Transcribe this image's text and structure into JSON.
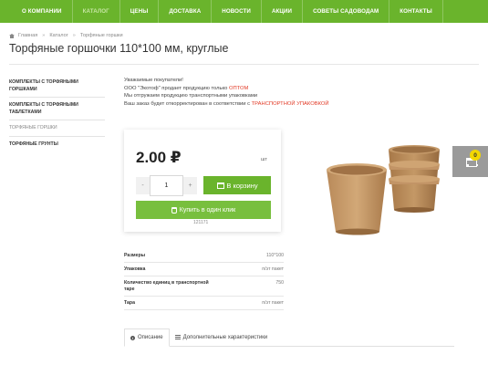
{
  "nav": {
    "items": [
      {
        "label": "О компании"
      },
      {
        "label": "Каталог"
      },
      {
        "label": "Цены"
      },
      {
        "label": "Доставка"
      },
      {
        "label": "Новости"
      },
      {
        "label": "Акции"
      },
      {
        "label": "Советы садоводам"
      },
      {
        "label": "Контакты"
      }
    ],
    "active_index": 1
  },
  "breadcrumb": {
    "home": "Главная",
    "catalog": "Каталог",
    "current": "Торфяные горшки"
  },
  "page_title": "Торфяные горшочки 110*100 мм, круглые",
  "sidebar": {
    "items": [
      {
        "label": "Комплекты с торфяными горшками"
      },
      {
        "label": "Комплекты с торфяными таблетками"
      },
      {
        "label": "Торфяные горшки"
      },
      {
        "label": "Торфяные грунты"
      }
    ]
  },
  "notice": {
    "line1": "Уважаемые покупатели!",
    "line2_prefix": "ООО \"Экотоф\" продает продукцию только ",
    "line2_highlight": "оптом",
    "line3": "Мы отгружаем продукцию транспортными упаковками",
    "line4_prefix": "Ваш заказ будет откорректирован в соответствии с ",
    "line4_highlight": "транспортной упаковкой"
  },
  "product": {
    "price": "2.00 ₽",
    "unit": "шт",
    "quantity": "1",
    "minus": "-",
    "plus": "+",
    "cart_button": "В корзину",
    "buy_one_click": "Купить в один клик",
    "code": "121171"
  },
  "specs": [
    {
      "label": "Размеры",
      "value": "110*100"
    },
    {
      "label": "Упаковка",
      "value": "п/эт пакет"
    },
    {
      "label": "Количество единиц в транспортной таре",
      "value": "750"
    },
    {
      "label": "Тара",
      "value": "п/эт пакет"
    }
  ],
  "tabs": [
    {
      "label": "Описание"
    },
    {
      "label": "Дополнительные характеристики"
    }
  ],
  "floating_cart": {
    "count": "0"
  },
  "colors": {
    "brand_green": "#6ab42c",
    "buy_green": "#78bf3e",
    "highlight_red": "#e23a26",
    "badge_yellow": "#f2d700",
    "float_cart_gray": "#9a9a9a"
  },
  "icons": {
    "home": "home-icon",
    "cart": "cart-icon",
    "hand": "hand-pointer-icon",
    "info": "info-icon",
    "list": "list-icon"
  }
}
